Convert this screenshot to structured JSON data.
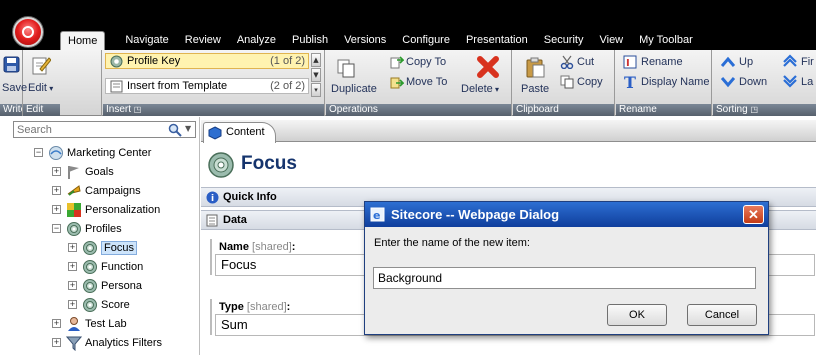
{
  "menu": {
    "tabs": [
      "Home",
      "Navigate",
      "Review",
      "Analyze",
      "Publish",
      "Versions",
      "Configure",
      "Presentation",
      "Security",
      "View",
      "My Toolbar"
    ],
    "active_tab": "Home"
  },
  "ribbon": {
    "write": {
      "save": "Save",
      "footer": "Write"
    },
    "edit": {
      "edit": "Edit",
      "footer": "Edit"
    },
    "insert": {
      "items": [
        {
          "label": "Profile Key",
          "count": "(1 of 2)"
        },
        {
          "label": "Insert from Template",
          "count": "(2 of 2)"
        }
      ],
      "footer": "Insert"
    },
    "operations": {
      "duplicate": "Duplicate",
      "copy_to": "Copy To",
      "move_to": "Move To",
      "delete": "Delete",
      "footer": "Operations"
    },
    "clipboard": {
      "paste": "Paste",
      "cut": "Cut",
      "copy": "Copy",
      "footer": "Clipboard"
    },
    "rename": {
      "rename": "Rename",
      "display_name": "Display Name",
      "footer": "Rename"
    },
    "sorting": {
      "up": "Up",
      "down": "Down",
      "first": "Fir",
      "last": "La",
      "footer": "Sorting"
    }
  },
  "search": {
    "placeholder": "Search"
  },
  "tree": [
    {
      "label": "Marketing Center",
      "expander": "−",
      "icon": "marketing-center-icon"
    },
    {
      "label": "Goals",
      "expander": "+",
      "icon": "goals-flag-icon"
    },
    {
      "label": "Campaigns",
      "expander": "+",
      "icon": "campaigns-icon"
    },
    {
      "label": "Personalization",
      "expander": "+",
      "icon": "personalization-icon"
    },
    {
      "label": "Profiles",
      "expander": "−",
      "icon": "profile-icon"
    },
    {
      "label": "Focus",
      "expander": "+",
      "icon": "profile-icon",
      "selected": true
    },
    {
      "label": "Function",
      "expander": "+",
      "icon": "profile-icon"
    },
    {
      "label": "Persona",
      "expander": "+",
      "icon": "profile-icon"
    },
    {
      "label": "Score",
      "expander": "+",
      "icon": "profile-icon"
    },
    {
      "label": "Test Lab",
      "expander": "+",
      "icon": "test-lab-icon"
    },
    {
      "label": "Analytics Filters",
      "expander": "+",
      "icon": "filter-icon"
    }
  ],
  "content": {
    "tab": "Content",
    "title": "Focus",
    "quick_info": "Quick Info",
    "section": "Data",
    "fields": [
      {
        "name": "Name",
        "shared": "[shared]",
        "value": "Focus"
      },
      {
        "name": "Type",
        "shared": "[shared]",
        "value": "Sum"
      }
    ]
  },
  "dialog": {
    "title": "Sitecore -- Webpage Dialog",
    "prompt": "Enter the name of the new item:",
    "value": "Background",
    "ok": "OK",
    "cancel": "Cancel"
  },
  "colors": {
    "title_blue": "#15346d",
    "dialog_title": "#1a4fb5",
    "ribbon_footer": "#56606c"
  }
}
